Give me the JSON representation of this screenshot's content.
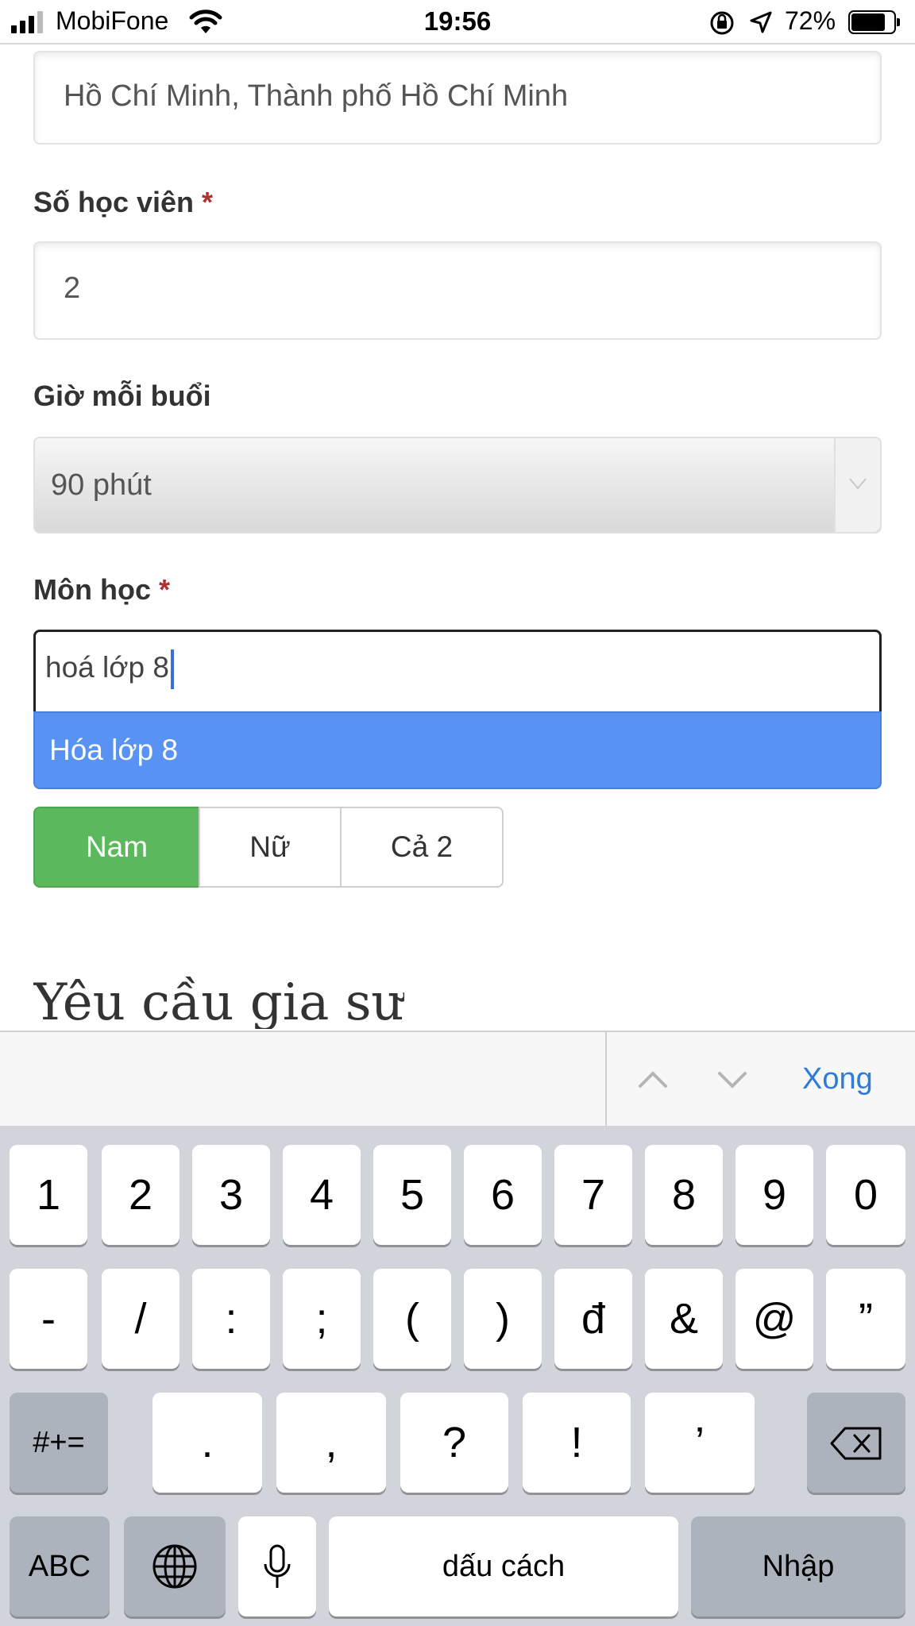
{
  "status_bar": {
    "carrier": "MobiFone",
    "time": "19:56",
    "battery_percent": "72%",
    "signal_bars": 3,
    "icons": [
      "signal-icon",
      "wifi-icon",
      "orientation-lock-icon",
      "location-arrow-icon",
      "battery-icon"
    ]
  },
  "form": {
    "address_value": "Hồ Chí Minh, Thành phố Hồ Chí Minh",
    "students_label": "Số học viên",
    "students_required": "*",
    "students_value": "2",
    "duration_label": "Giờ mỗi buổi",
    "duration_value": "90 phút",
    "subject_label": "Môn học",
    "subject_required": "*",
    "subject_value": "hoá lớp 8",
    "suggestion": "Hóa lớp 8",
    "gender_options": [
      "Nam",
      "Nữ",
      "Cả 2"
    ],
    "gender_selected": "Nam",
    "section_title": "Yêu cầu gia sư"
  },
  "keyboard_toolbar": {
    "done_label": "Xong"
  },
  "keyboard": {
    "row1": [
      "1",
      "2",
      "3",
      "4",
      "5",
      "6",
      "7",
      "8",
      "9",
      "0"
    ],
    "row2": [
      "-",
      "/",
      ":",
      ";",
      "(",
      ")",
      "đ",
      "&",
      "@",
      "”"
    ],
    "row3_left": "#+=",
    "row3": [
      ".",
      ",",
      "?",
      "!",
      "’"
    ],
    "abc_label": "ABC",
    "space_label": "dấu cách",
    "return_label": "Nhập"
  },
  "colors": {
    "accent_blue": "#5893f3",
    "selected_green": "#5cb85c",
    "required_red": "#b03030",
    "link_blue": "#2f7bd8"
  }
}
